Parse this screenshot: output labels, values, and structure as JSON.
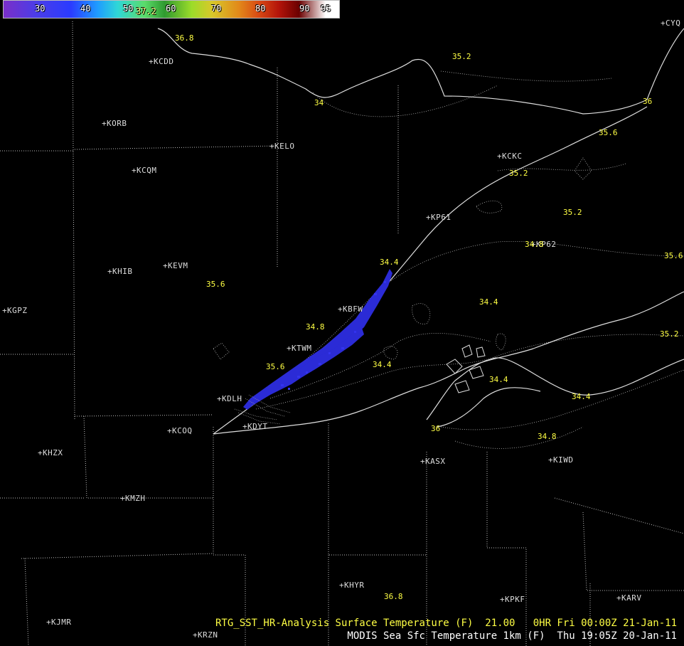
{
  "colorbar": {
    "labels": [
      "30",
      "40",
      "50",
      "60",
      "70",
      "80",
      "90",
      "95"
    ],
    "readout": "37.2"
  },
  "stations": {
    "KCDD": "KCDD",
    "KORB": "KORB",
    "KCQM": "KCQM",
    "KELO": "KELO",
    "KHIB": "KHIB",
    "KEVM": "KEVM",
    "KGPZ": "KGPZ",
    "KCKC": "KCKC",
    "KP61": "KP61",
    "KP62": "KP62",
    "KBFW": "KBFW",
    "KTWM": "KTWM",
    "KDLH": "KDLH",
    "KCOQ": "KCOQ",
    "KDYT": "KDYT",
    "KHZX": "KHZX",
    "KMZH": "KMZH",
    "KASX": "KASX",
    "KIWD": "KIWD",
    "KHYR": "KHYR",
    "KPKF": "KPKF",
    "KARV": "KARV",
    "KJMR": "KJMR",
    "KRZN": "KRZN",
    "CYQ": "CYQ"
  },
  "isotherms": {
    "v368a": "36.8",
    "v352a": "35.2",
    "v34a": "34",
    "v36a": "36",
    "v356a": "35.6",
    "v352b": "35.2",
    "v352c": "35.2",
    "v348a": "34.8",
    "v356b": "35.6",
    "v344a": "34.4",
    "v344b": "34.4",
    "v348b": "34.8",
    "v344c": "34.4",
    "v356c": "35.6",
    "v36b": "36",
    "v344d": "34.4",
    "v352d": "35.2",
    "v348c": "34.8",
    "v344e": "34.4",
    "v368b": "36.8",
    "v356d": "35.6"
  },
  "footer": {
    "line1": "RTG_SST_HR-Analysis Surface Temperature (F)  21.00   0HR Fri 00:00Z 21-Jan-11",
    "line2": "MODIS Sea Sfc Temperature 1km (F)  Thu 19:05Z 20-Jan-11"
  }
}
